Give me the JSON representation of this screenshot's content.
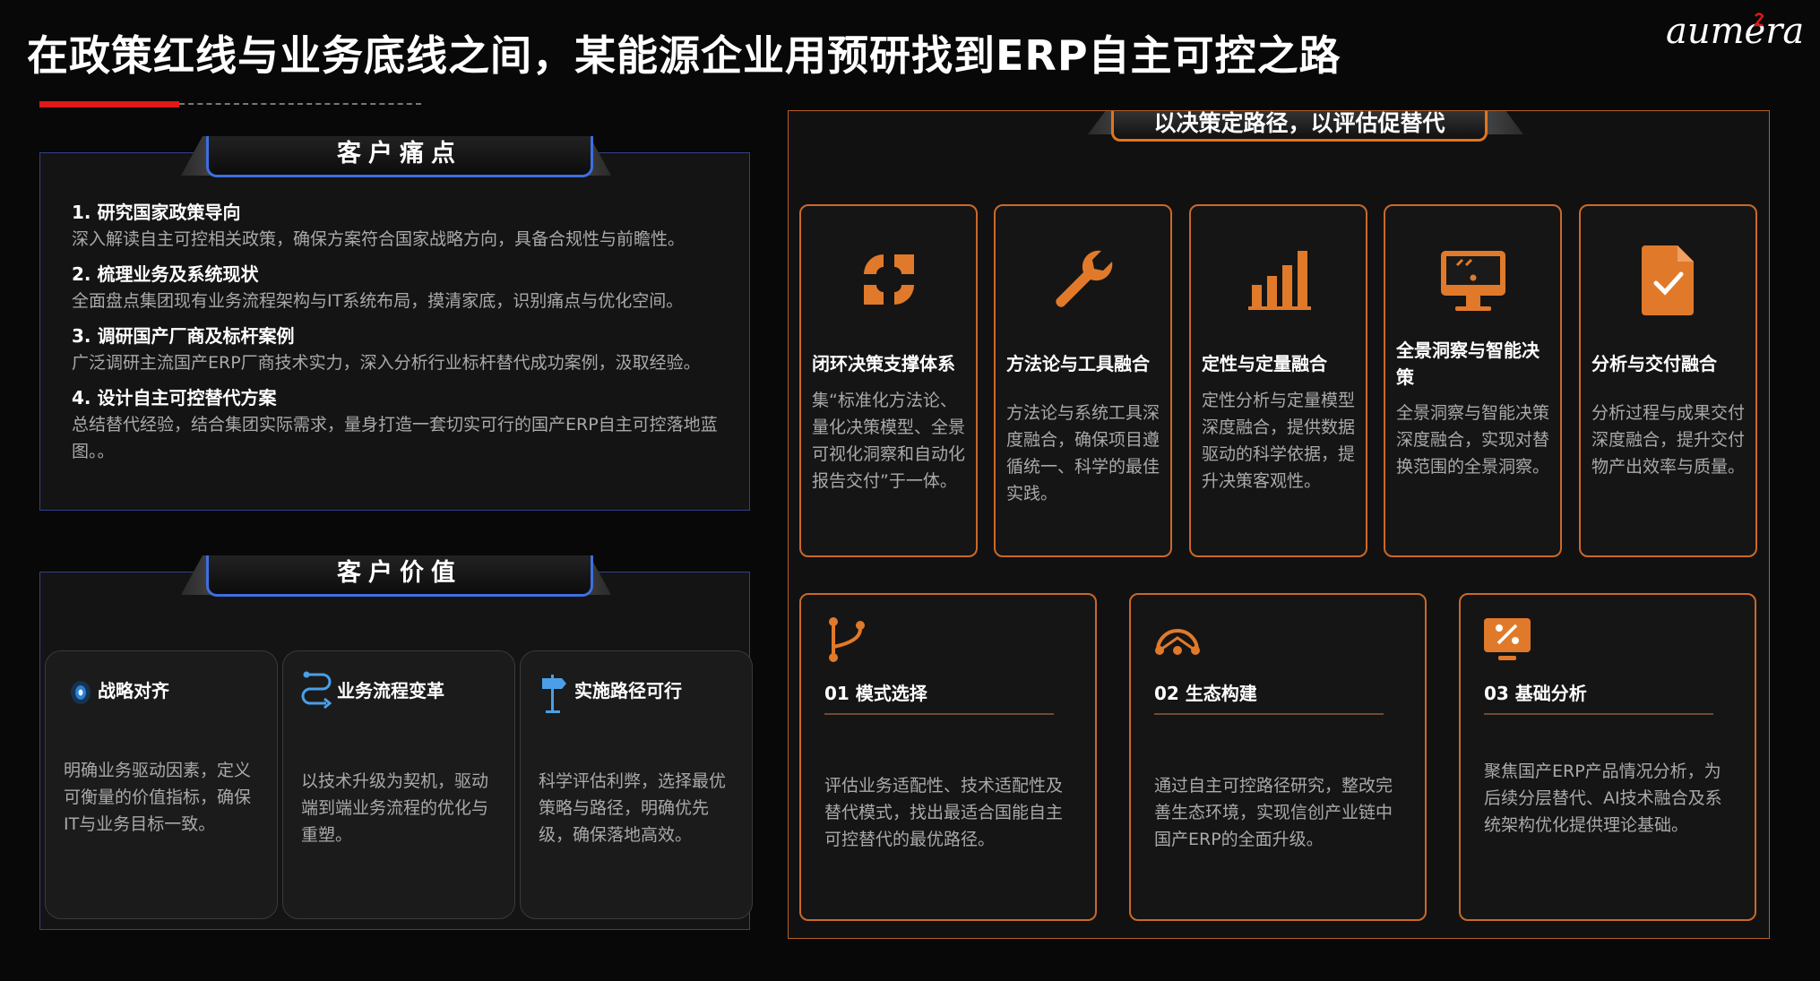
{
  "title": "在政策红线与业务底线之间，某能源企业用预研找到ERP自主可控之路",
  "logo_text": "aumera",
  "pain": {
    "tab_label": "客户痛点",
    "items": [
      {
        "heading": "1. 研究国家政策导向",
        "desc": "深入解读自主可控相关政策，确保方案符合国家战略方向，具备合规性与前瞻性。"
      },
      {
        "heading": "2. 梳理业务及系统现状",
        "desc": "全面盘点集团现有业务流程架构与IT系统布局，摸清家底，识别痛点与优化空间。"
      },
      {
        "heading": "3. 调研国产厂商及标杆案例",
        "desc": "广泛调研主流国产ERP厂商技术实力，深入分析行业标杆替代成功案例，汲取经验。"
      },
      {
        "heading": "4. 设计自主可控替代方案",
        "desc": "总结替代经验，结合集团实际需求，量身打造一套切实可行的国产ERP自主可控落地蓝图。。"
      }
    ]
  },
  "value": {
    "tab_label": "客户价值",
    "cards": [
      {
        "title": "战略对齐",
        "icon": "target-icon",
        "desc": "明确业务驱动因素，定义可衡量的价值指标，确保IT与业务目标一致。"
      },
      {
        "title": "业务流程变革",
        "icon": "flow-icon",
        "desc": "以技术升级为契机，驱动端到端业务流程的优化与重塑。"
      },
      {
        "title": "实施路径可行",
        "icon": "signpost-icon",
        "desc": "科学评估利弊，选择最优策略与路径，明确优先级，确保落地高效。"
      }
    ]
  },
  "right": {
    "tab_label": "以决策定路径，以评估促替代",
    "cards": [
      {
        "title": "闭环决策支撑体系",
        "icon": "loop-icon",
        "desc": "集“标准化方法论、量化决策模型、全景可视化洞察和自动化报告交付”于一体。"
      },
      {
        "title": "方法论与工具融合",
        "icon": "wrench-icon",
        "desc": "方法论与系统工具深度融合，确保项目遵循统一、科学的最佳实践。"
      },
      {
        "title": "定性与定量融合",
        "icon": "bar-chart-icon",
        "desc": "定性分析与定量模型深度融合，提供数据驱动的科学依据，提升决策客观性。"
      },
      {
        "title": "全景洞察与智能决策",
        "icon": "monitor-icon",
        "desc": "全景洞察与智能决策深度融合，实现对替换范围的全景洞察。"
      },
      {
        "title": "分析与交付融合",
        "icon": "document-check-icon",
        "desc": "分析过程与成果交付深度融合，提升交付物产出效率与质量。"
      }
    ],
    "bottom_cards": [
      {
        "title": "01 模式选择",
        "icon": "branch-icon",
        "desc": "评估业务适配性、技术适配性及替代模式，找出最适合国能自主可控替代的最优路径。"
      },
      {
        "title": "02 生态构建",
        "icon": "ecosystem-icon",
        "desc": "通过自主可控路径研究，整改完善生态环境，实现信创产业链中国产ERP的全面升级。"
      },
      {
        "title": "03 基础分析",
        "icon": "analysis-icon",
        "desc": "聚焦国产ERP产品情况分析，为后续分层替代、AI技术融合及系统架构优化提供理论基础。"
      }
    ]
  },
  "colors": {
    "accent_orange": "#e0761d",
    "accent_blue": "#3f6fe0",
    "accent_red": "#e01818"
  }
}
